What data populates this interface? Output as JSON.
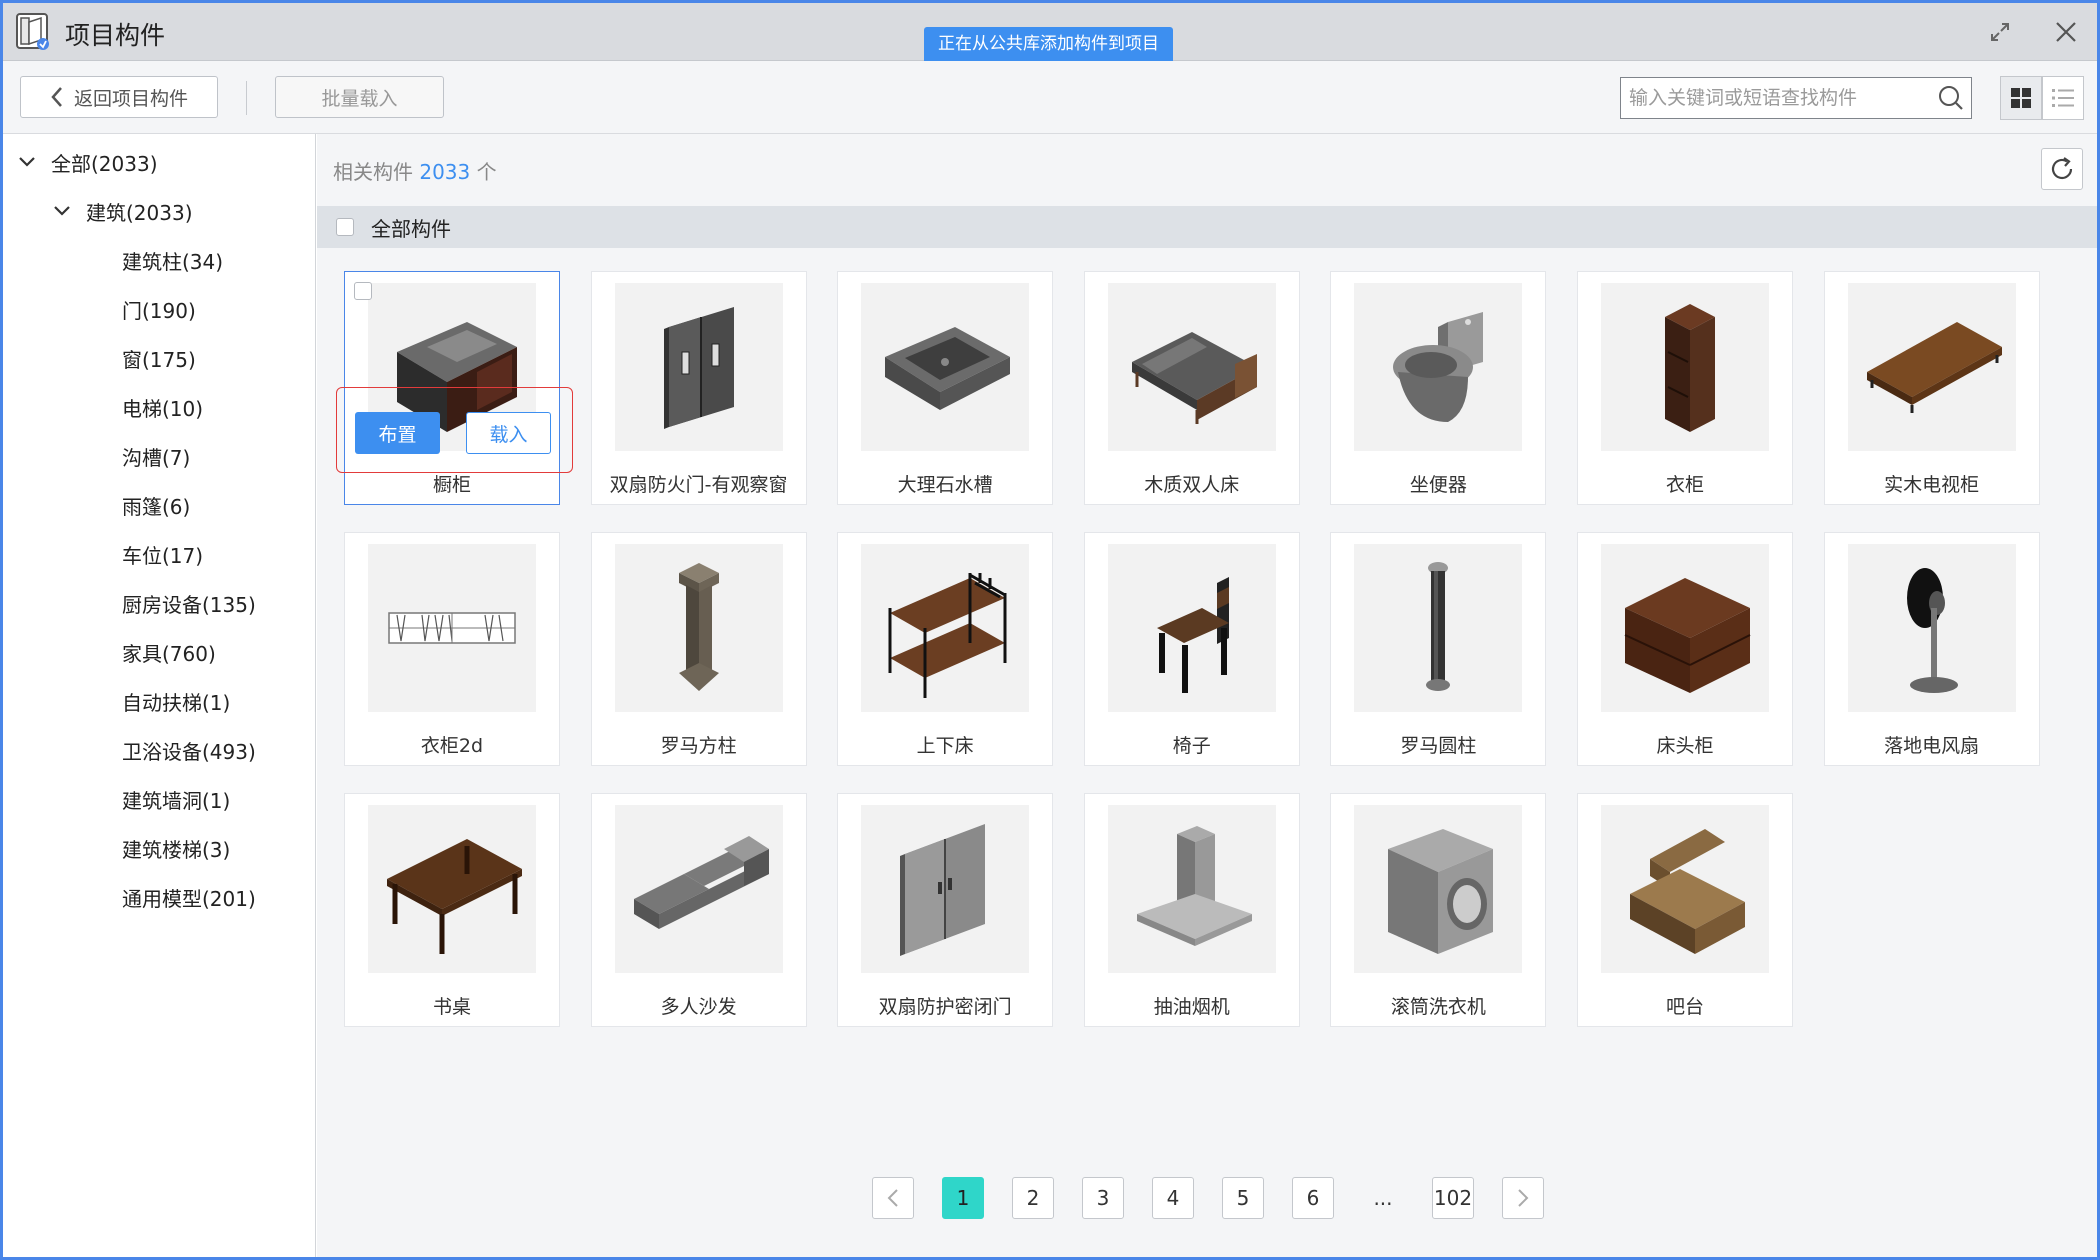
{
  "window": {
    "title": "项目构件",
    "banner": "正在从公共库添加构件到项目"
  },
  "toolbar": {
    "back_label": "返回项目构件",
    "batch_label": "批量载入",
    "search_placeholder": "输入关键词或短语查找构件"
  },
  "sidebar": {
    "root": "全部(2033)",
    "group": "建筑(2033)",
    "items": [
      "建筑柱(34)",
      "门(190)",
      "窗(175)",
      "电梯(10)",
      "沟槽(7)",
      "雨篷(6)",
      "车位(17)",
      "厨房设备(135)",
      "家具(760)",
      "自动扶梯(1)",
      "卫浴设备(493)",
      "建筑墙洞(1)",
      "建筑楼梯(3)",
      "通用模型(201)"
    ]
  },
  "main": {
    "related_prefix": "相关构件",
    "related_count": "2033",
    "related_suffix": "个",
    "all_label": "全部构件",
    "place_label": "布置",
    "load_label": "载入",
    "cards": [
      {
        "name": "橱柜",
        "icon": "cabinet-icon"
      },
      {
        "name": "双扇防火门-有观察窗",
        "icon": "fire-door-icon"
      },
      {
        "name": "大理石水槽",
        "icon": "marble-sink-icon"
      },
      {
        "name": "木质双人床",
        "icon": "double-bed-icon"
      },
      {
        "name": "坐便器",
        "icon": "toilet-icon"
      },
      {
        "name": "衣柜",
        "icon": "wardrobe-icon"
      },
      {
        "name": "实木电视柜",
        "icon": "tv-cabinet-icon"
      },
      {
        "name": "衣柜2d",
        "icon": "wardrobe-2d-icon"
      },
      {
        "name": "罗马方柱",
        "icon": "square-column-icon"
      },
      {
        "name": "上下床",
        "icon": "bunk-bed-icon"
      },
      {
        "name": "椅子",
        "icon": "chair-icon"
      },
      {
        "name": "罗马圆柱",
        "icon": "round-column-icon"
      },
      {
        "name": "床头柜",
        "icon": "nightstand-icon"
      },
      {
        "name": "落地电风扇",
        "icon": "floor-fan-icon"
      },
      {
        "name": "书桌",
        "icon": "desk-icon"
      },
      {
        "name": "多人沙发",
        "icon": "sofa-icon"
      },
      {
        "name": "双扇防护密闭门",
        "icon": "blast-door-icon"
      },
      {
        "name": "抽油烟机",
        "icon": "range-hood-icon"
      },
      {
        "name": "滚筒洗衣机",
        "icon": "washing-machine-icon"
      },
      {
        "name": "吧台",
        "icon": "bar-counter-icon"
      }
    ]
  },
  "pagination": {
    "pages": [
      "1",
      "2",
      "3",
      "4",
      "5",
      "6",
      "...",
      "102"
    ],
    "current": "1"
  },
  "colors": {
    "accent": "#3d8ff0",
    "window_border": "#4a86e8",
    "active_page": "#2fd6c9",
    "highlight": "#e23b3b"
  }
}
